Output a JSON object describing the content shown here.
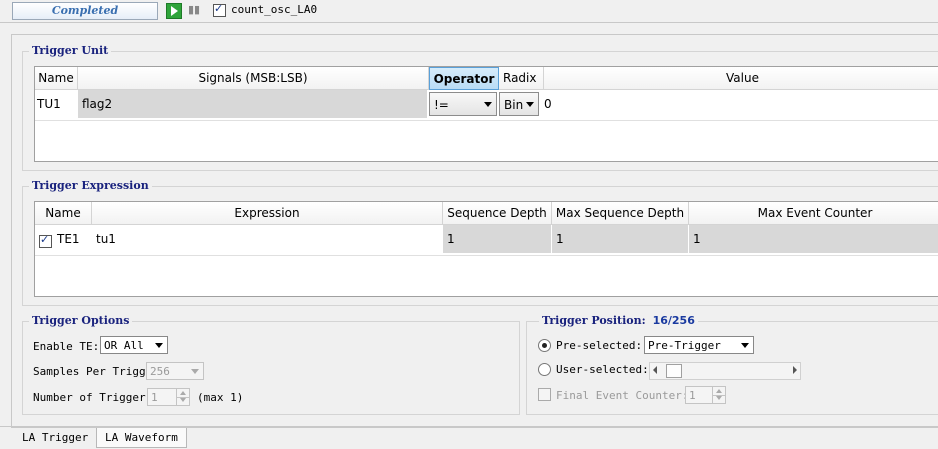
{
  "toolbar": {
    "status": "Completed",
    "checkbox_label": "count_osc_LA0"
  },
  "trigger_unit": {
    "title": "Trigger Unit",
    "columns": [
      "Name",
      "Signals (MSB:LSB)",
      "Operator",
      "Radix",
      "Value"
    ],
    "rows": [
      {
        "name": "TU1",
        "signals": "flag2",
        "operator": "!=",
        "radix": "Bin",
        "value": "0"
      }
    ]
  },
  "trigger_expression": {
    "title": "Trigger Expression",
    "columns": [
      "Name",
      "Expression",
      "Sequence Depth",
      "Max Sequence Depth",
      "Max Event Counter"
    ],
    "rows": [
      {
        "name": "TE1",
        "checked": true,
        "expression": "tu1",
        "sequence_depth": "1",
        "max_sequence_depth": "1",
        "max_event_counter": "1"
      }
    ]
  },
  "trigger_options": {
    "title": "Trigger Options",
    "enable_te_label": "Enable TE:",
    "enable_te_value": "OR All",
    "samples_label": "Samples Per Trigger:",
    "samples_value": "256",
    "number_label": "Number of Trigger:",
    "number_value": "1",
    "number_hint": "(max 1)"
  },
  "trigger_position": {
    "title": "Trigger Position:",
    "position_value": "16/256",
    "preselected_label": "Pre-selected:",
    "preselected_value": "Pre-Trigger",
    "user_selected_label": "User-selected:",
    "final_event_label": "Final Event Counter:",
    "final_event_value": "1",
    "slider_level": 0
  },
  "tabs": [
    "LA Trigger",
    "LA Waveform"
  ]
}
